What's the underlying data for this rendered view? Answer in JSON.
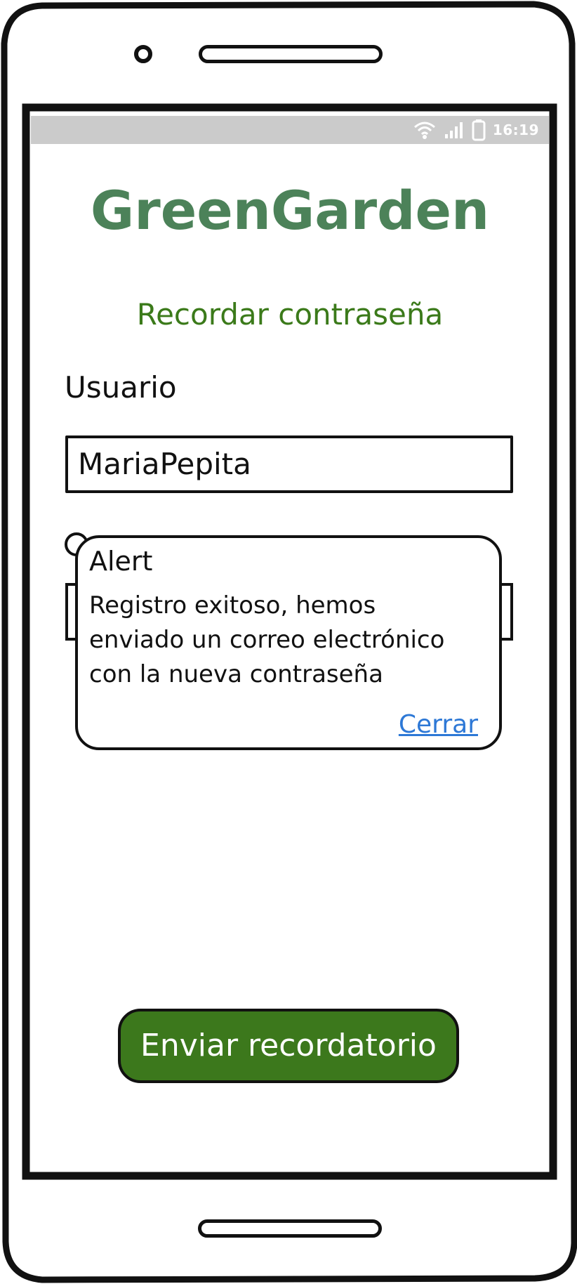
{
  "status_bar": {
    "time": "16:19",
    "icons": [
      "wifi-icon",
      "signal-icon",
      "battery-icon"
    ]
  },
  "app": {
    "title": "GreenGarden"
  },
  "screen": {
    "title": "Recordar contraseña"
  },
  "form": {
    "user_label": "Usuario",
    "user_value": "MariaPepita"
  },
  "alert": {
    "title": "Alert",
    "message_lines": [
      "Registro exitoso, hemos",
      "enviado un correo electrónico",
      "con la nueva contraseña"
    ],
    "close_label": "Cerrar"
  },
  "actions": {
    "send_label": "Enviar recordatorio"
  },
  "colors": {
    "brand_green": "#4c8259",
    "title_green": "#3b7a1a",
    "button_green": "#3c781c",
    "link_blue": "#2d78d6",
    "status_bar_gray": "#cbcbcb"
  }
}
